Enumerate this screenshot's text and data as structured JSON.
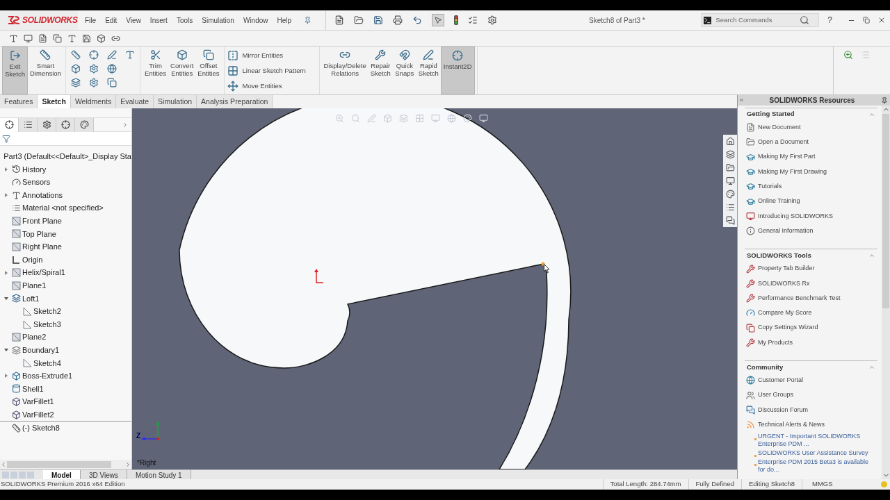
{
  "app": {
    "logo": "SOLIDWORKS",
    "menu": [
      "File",
      "Edit",
      "View",
      "Insert",
      "Tools",
      "Simulation",
      "Window",
      "Help"
    ],
    "document_title": "Sketch8 of Part3 *",
    "search": {
      "placeholder": "Search Commands"
    },
    "help": "?"
  },
  "command_groups": [
    {
      "kind": "large",
      "commands": [
        {
          "label": "Exit Sketch",
          "on": true
        },
        {
          "label": "Smart Dimension",
          "on": false
        }
      ]
    },
    {
      "kind": "tools"
    },
    {
      "kind": "large",
      "commands": [
        {
          "label": "Trim Entities",
          "on": false
        },
        {
          "label": "Convert Entities",
          "on": false
        },
        {
          "label": "Offset Entities",
          "on": false
        }
      ]
    },
    {
      "kind": "rows",
      "commands": [
        {
          "label": "Mirror Entities",
          "on": false
        },
        {
          "label": "Linear Sketch Pattern",
          "on": false
        },
        {
          "label": "Move Entities",
          "on": false
        }
      ]
    },
    {
      "kind": "large",
      "commands": [
        {
          "label": "Display/Delete Relations",
          "on": false
        },
        {
          "label": "Repair Sketch",
          "on": false
        },
        {
          "label": "Quick Snaps",
          "on": false
        },
        {
          "label": "Rapid Sketch",
          "on": false
        },
        {
          "label": "Instant2D",
          "on": true
        }
      ]
    }
  ],
  "panel_tabs": [
    {
      "selected": true
    },
    {
      "selected": false
    },
    {
      "selected": false
    },
    {
      "selected": false
    },
    {
      "selected": false
    }
  ],
  "tabs": [
    {
      "label": "Features",
      "selected": false
    },
    {
      "label": "Sketch",
      "selected": true
    },
    {
      "label": "Weldments",
      "selected": false
    },
    {
      "label": "Evaluate",
      "selected": false
    },
    {
      "label": "Simulation",
      "selected": false
    },
    {
      "label": "Analysis Preparation",
      "selected": false
    }
  ],
  "tree": {
    "root": "Part3  (Default<<Default>_Display Sta",
    "items": [
      {
        "label": "History",
        "kind": "history",
        "expanded": false
      },
      {
        "label": "Sensors",
        "kind": "sensors"
      },
      {
        "label": "Annotations",
        "kind": "annotations",
        "expanded": false
      },
      {
        "label": "Material <not specified>",
        "kind": "material"
      },
      {
        "label": "Front Plane",
        "kind": "plane"
      },
      {
        "label": "Top Plane",
        "kind": "plane"
      },
      {
        "label": "Right Plane",
        "kind": "plane"
      },
      {
        "label": "Origin",
        "kind": "origin"
      },
      {
        "label": "Helix/Spiral1",
        "kind": "helix",
        "expanded": false
      },
      {
        "label": "Plane1",
        "kind": "plane"
      },
      {
        "label": "Loft1",
        "kind": "loft",
        "expanded": true,
        "children": [
          {
            "label": "Sketch2",
            "kind": "sketch"
          },
          {
            "label": "Sketch3",
            "kind": "sketch"
          }
        ]
      },
      {
        "label": "Plane2",
        "kind": "plane"
      },
      {
        "label": "Boundary1",
        "kind": "boundary",
        "expanded": true,
        "children": [
          {
            "label": "Sketch4",
            "kind": "sketch"
          }
        ]
      },
      {
        "label": "Boss-Extrude1",
        "kind": "extrude",
        "expanded": false
      },
      {
        "label": "Shell1",
        "kind": "shell"
      },
      {
        "label": "VarFillet1",
        "kind": "fillet"
      },
      {
        "label": "VarFillet2",
        "kind": "fillet"
      },
      {
        "label": "(-) Sketch8",
        "kind": "active_sketch"
      }
    ]
  },
  "viewport": {
    "view_label": "*Right",
    "triad_label": "Z"
  },
  "bottom_tabs": [
    {
      "label": "Model",
      "selected": true
    },
    {
      "label": "3D Views",
      "selected": false
    },
    {
      "label": "Motion Study 1",
      "selected": false
    }
  ],
  "task_pane": {
    "collapse": "«",
    "title": "SOLIDWORKS Resources",
    "sections": [
      {
        "title": "Getting Started",
        "expanded": true,
        "items": [
          {
            "label": "New Document",
            "kind": "document"
          },
          {
            "label": "Open a Document",
            "kind": "open"
          },
          {
            "label": "Making My First Part",
            "kind": "course"
          },
          {
            "label": "Making My First Drawing",
            "kind": "course"
          },
          {
            "label": "Tutorials",
            "kind": "course"
          },
          {
            "label": "Online Training",
            "kind": "course"
          },
          {
            "label": "Introducing SOLIDWORKS",
            "kind": "intro"
          },
          {
            "label": "General Information",
            "kind": "info"
          }
        ]
      },
      {
        "title": "SOLIDWORKS Tools",
        "expanded": true,
        "items": [
          {
            "label": "Property Tab Builder",
            "kind": "tool"
          },
          {
            "label": "SOLIDWORKS Rx",
            "kind": "tool"
          },
          {
            "label": "Performance Benchmark Test",
            "kind": "tool"
          },
          {
            "label": "Compare My Score",
            "kind": "score"
          },
          {
            "label": "Copy Settings Wizard",
            "kind": "wizard"
          },
          {
            "label": "My Products",
            "kind": "tool"
          }
        ]
      },
      {
        "title": "Community",
        "expanded": true,
        "items": [
          {
            "label": "Customer Portal",
            "kind": "portal"
          },
          {
            "label": "User Groups",
            "kind": "groups"
          },
          {
            "label": "Discussion Forum",
            "kind": "forum"
          },
          {
            "label": "Technical Alerts & News",
            "kind": "rss"
          },
          {
            "label": "URGENT - Important SOLIDWORKS Enterprise PDM ...",
            "kind": "news"
          },
          {
            "label": "SOLIDWORKS User Assistance Survey",
            "kind": "news"
          },
          {
            "label": "Enterprise PDM 2015 Beta3 is available for do...",
            "kind": "news"
          }
        ]
      }
    ]
  },
  "status_bar": [
    {
      "text": "SOLIDWORKS Premium 2016 x64 Edition",
      "kind": "edition"
    },
    {
      "text": "Total Length: 284.74mm",
      "kind": "field"
    },
    {
      "text": "Fully Defined",
      "kind": "field"
    },
    {
      "text": "Editing Sketch8",
      "kind": "field"
    },
    {
      "text": "MMGS",
      "kind": "units"
    }
  ]
}
